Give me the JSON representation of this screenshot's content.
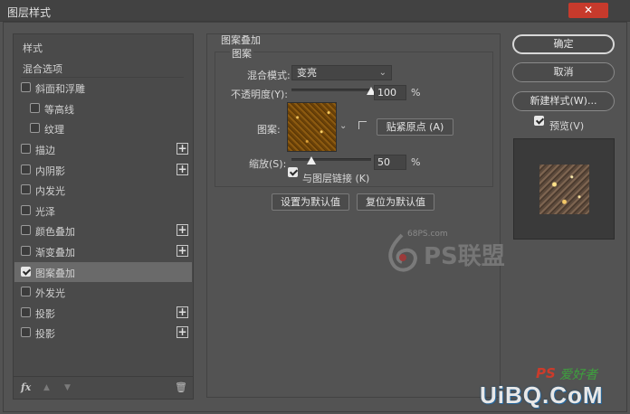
{
  "window": {
    "title": "图层样式",
    "close_label": "✕"
  },
  "styles_list": {
    "items": [
      {
        "label": "样式",
        "checkbox": false,
        "checked": false,
        "plus": false,
        "indent": false,
        "selected": false
      },
      {
        "label": "混合选项",
        "checkbox": false,
        "checked": false,
        "plus": false,
        "indent": false,
        "selected": false
      },
      {
        "label": "斜面和浮雕",
        "checkbox": true,
        "checked": false,
        "plus": false,
        "indent": false,
        "selected": false
      },
      {
        "label": "等高线",
        "checkbox": true,
        "checked": false,
        "plus": false,
        "indent": true,
        "selected": false
      },
      {
        "label": "纹理",
        "checkbox": true,
        "checked": false,
        "plus": false,
        "indent": true,
        "selected": false
      },
      {
        "label": "描边",
        "checkbox": true,
        "checked": false,
        "plus": true,
        "indent": false,
        "selected": false
      },
      {
        "label": "内阴影",
        "checkbox": true,
        "checked": false,
        "plus": true,
        "indent": false,
        "selected": false
      },
      {
        "label": "内发光",
        "checkbox": true,
        "checked": false,
        "plus": false,
        "indent": false,
        "selected": false
      },
      {
        "label": "光泽",
        "checkbox": true,
        "checked": false,
        "plus": false,
        "indent": false,
        "selected": false
      },
      {
        "label": "颜色叠加",
        "checkbox": true,
        "checked": false,
        "plus": true,
        "indent": false,
        "selected": false
      },
      {
        "label": "渐变叠加",
        "checkbox": true,
        "checked": false,
        "plus": true,
        "indent": false,
        "selected": false
      },
      {
        "label": "图案叠加",
        "checkbox": true,
        "checked": true,
        "plus": false,
        "indent": false,
        "selected": true
      },
      {
        "label": "外发光",
        "checkbox": true,
        "checked": false,
        "plus": false,
        "indent": false,
        "selected": false
      },
      {
        "label": "投影",
        "checkbox": true,
        "checked": false,
        "plus": true,
        "indent": false,
        "selected": false
      },
      {
        "label": "投影",
        "checkbox": true,
        "checked": false,
        "plus": true,
        "indent": false,
        "selected": false
      }
    ],
    "footer": {
      "fx": "fx",
      "up": "▲",
      "down": "▼",
      "trash": "🗑"
    }
  },
  "pattern_overlay": {
    "section_title": "图案叠加",
    "group_title": "图案",
    "blend_mode_label": "混合模式:",
    "blend_mode_value": "变亮",
    "opacity_label": "不透明度(Y):",
    "opacity_value": "100",
    "opacity_fraction": 1.0,
    "pattern_label": "图案:",
    "snap_origin_button": "贴紧原点 (A)",
    "scale_label": "缩放(S):",
    "scale_value": "50",
    "scale_fraction": 0.25,
    "percent": "%",
    "link_layer_label": "与图层链接 (K)",
    "link_layer_checked": true,
    "set_default_button": "设置为默认值",
    "reset_default_button": "复位为默认值"
  },
  "actions": {
    "ok": "确定",
    "cancel": "取消",
    "new_style": "新建样式(W)...",
    "preview_label": "预览(V)",
    "preview_checked": true
  },
  "watermarks": {
    "site_small": "68PS.com",
    "logo_text": "PS联盟",
    "bottom_ps": "PS",
    "bottom_cn": "爱好者",
    "bottom_brand": "UiBQ.CoM"
  }
}
